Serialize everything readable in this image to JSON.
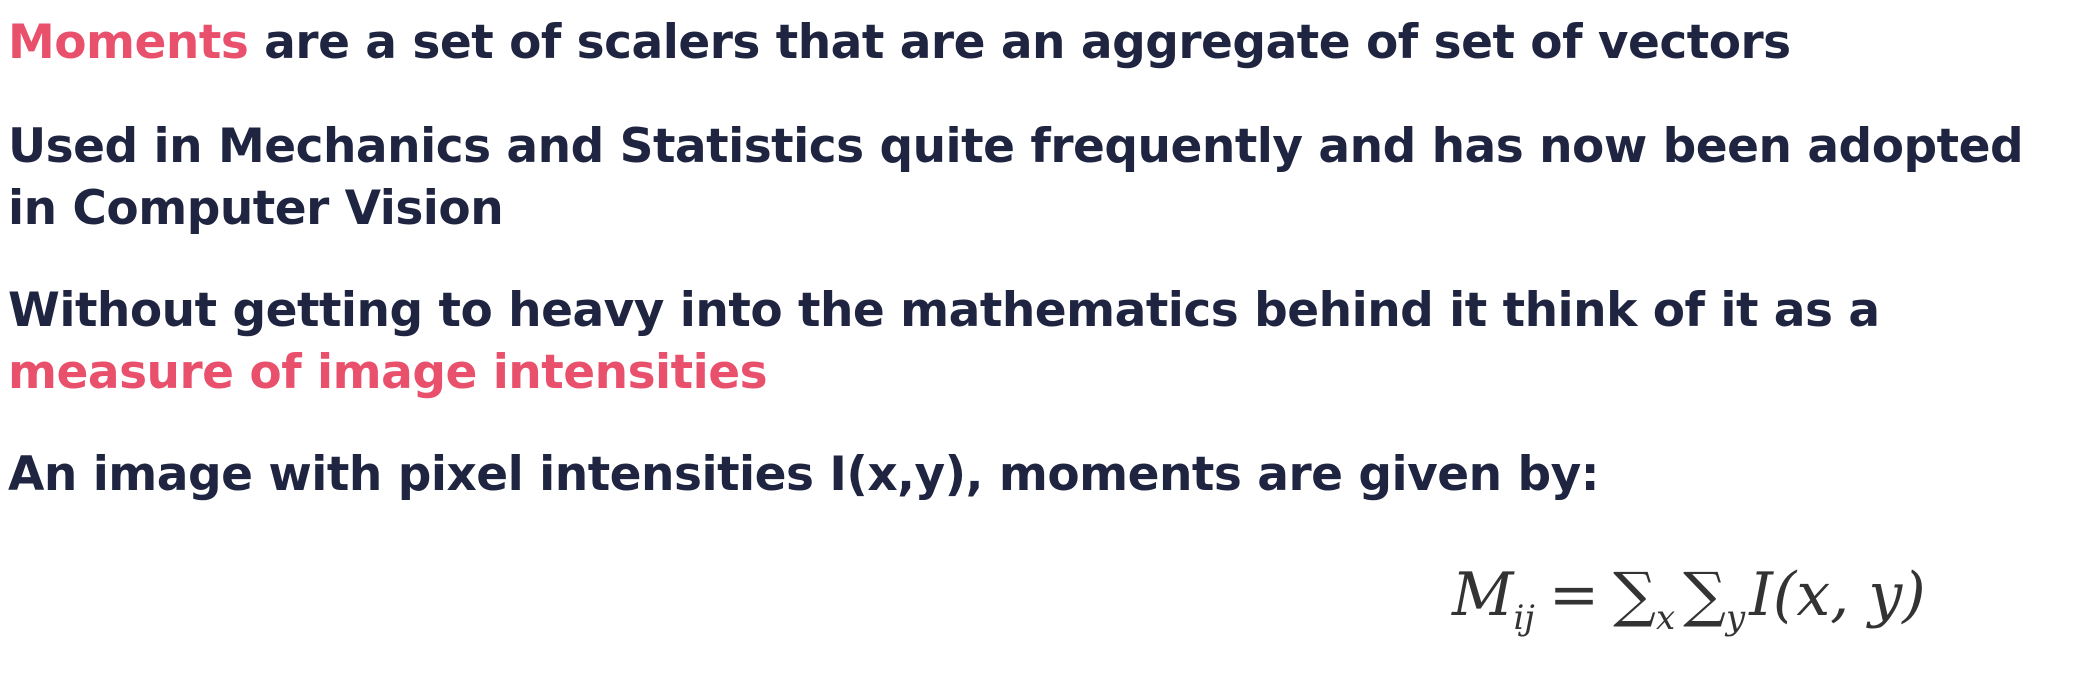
{
  "paragraphs": {
    "p1": {
      "highlight": "Moments",
      "rest": " are a set of scalers that are an aggregate of set of vectors"
    },
    "p2": {
      "text": "Used in Mechanics and Statistics quite frequently and has now been adopted in Computer Vision"
    },
    "p3": {
      "text": "Without getting to heavy into the mathematics behind it think of it as a ",
      "highlight": "measure of image intensities"
    },
    "p4": {
      "text": "An image with pixel intensities I(x,y), moments are given by:"
    }
  },
  "formula": {
    "lhs": "M",
    "lhs_sub": "ij",
    "equals": "=",
    "sum1": "∑",
    "sum1_sub": "x",
    "sum2": "∑",
    "sum2_sub": "y",
    "rhs": "I(x, y)"
  },
  "colors": {
    "text": "#1f2440",
    "accent": "#e8506b",
    "formula": "#333333"
  }
}
